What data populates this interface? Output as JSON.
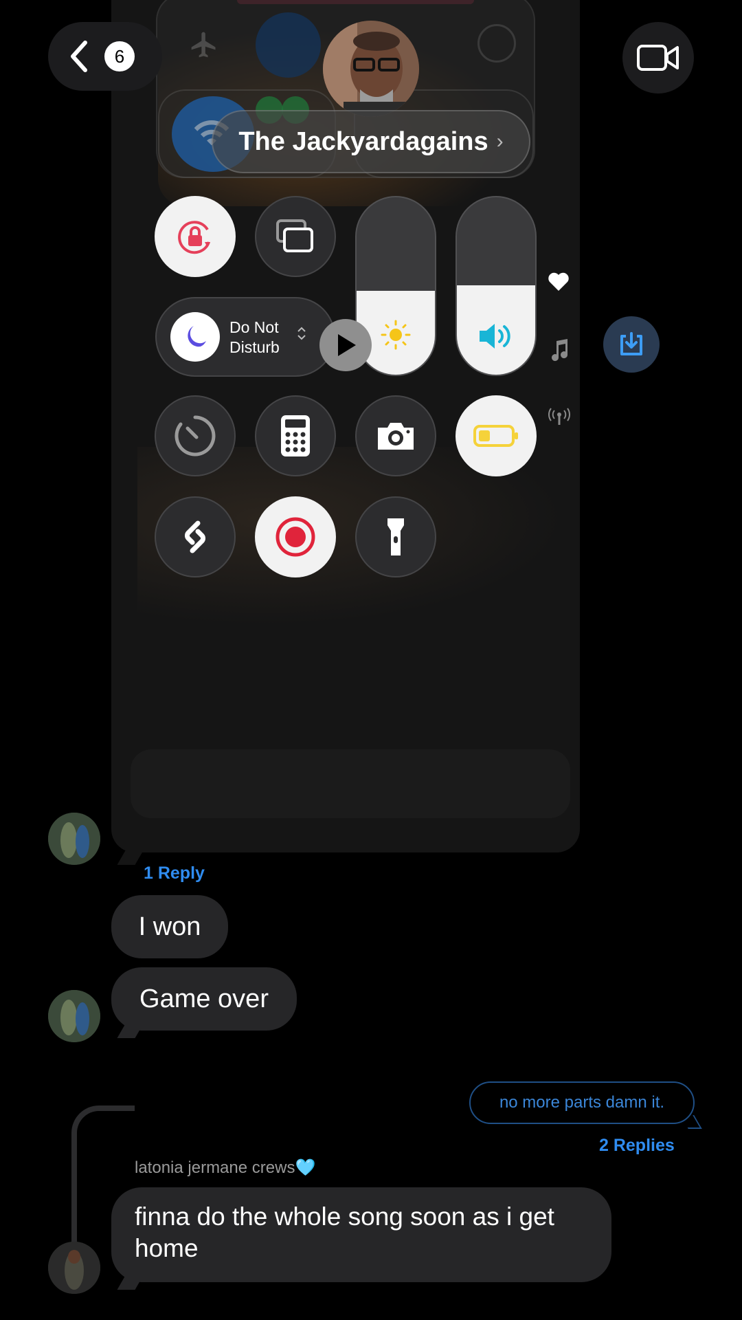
{
  "header": {
    "unread_count": "6",
    "group_name": "The Jackyardagains",
    "chevron": "›"
  },
  "screenshot": {
    "focus_label_line1": "Do Not",
    "focus_label_line2": "Disturb",
    "brightness_level": 0.5,
    "volume_level": 0.55,
    "icons": [
      "airplane-icon",
      "airdrop-icon",
      "wifi-icon",
      "bluetooth-icon",
      "screen-mirroring-icon",
      "rotation-lock-icon",
      "screen-mirror-icon",
      "moon-icon",
      "play-icon",
      "sun-icon",
      "speaker-icon",
      "timer-icon",
      "calculator-icon",
      "camera-icon",
      "battery-icon",
      "shazam-icon",
      "record-icon",
      "flashlight-icon"
    ]
  },
  "side_icons": [
    "heart-icon",
    "music-note-icon",
    "signal-icon"
  ],
  "messages": {
    "reply_link_1": "1 Reply",
    "msg_1": "I won",
    "msg_2": "Game over",
    "sent_msg": "no more parts damn it.",
    "reply_link_2": "2 Replies",
    "sender_name": "latonia jermane crews",
    "sender_emoji": "🩵",
    "msg_3_line1": "finna do the whole song soon as i get",
    "msg_3_line2": "home"
  },
  "colors": {
    "accent_blue": "#2f8cf0",
    "bubble_gray": "#262628",
    "record_red": "#e0243b",
    "battery_yellow": "#f5d23a"
  }
}
